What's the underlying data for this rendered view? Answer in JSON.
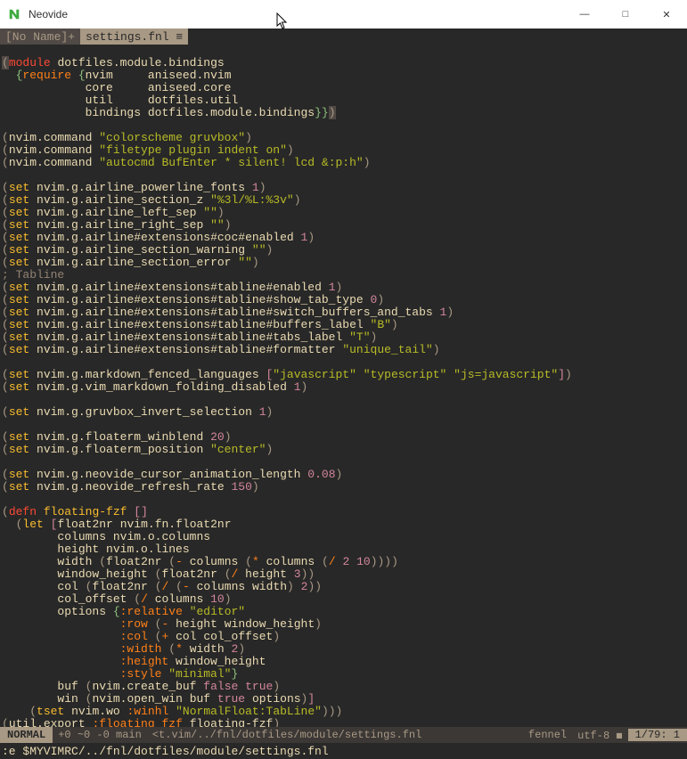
{
  "window": {
    "title": "Neovide",
    "min": "—",
    "max": "□",
    "close": "✕"
  },
  "tabs": {
    "inactive_label": "[No Name]+  ",
    "active_label": " settings.fnl ≡ "
  },
  "code": {
    "l1_mod": "module",
    "l1_name": "dotfiles.module.bindings",
    "l2_req": "require",
    "l2_nvim": "nvim",
    "l2_anvim": "aniseed.nvim",
    "l3_core": "core",
    "l3_acore": "aniseed.core",
    "l4_util": "util",
    "l4_dutil": "dotfiles.util",
    "l5_bind": "bindings",
    "l5_dbind": "dotfiles.module.bindings",
    "cmd": "nvim.command",
    "cs": "\"colorscheme gruvbox\"",
    "ft": "\"filetype plugin indent on\"",
    "ac": "\"autocmd BufEnter * silent! lcd &:p:h\"",
    "set": "set",
    "s1": "nvim.g.airline_powerline_fonts",
    "n1": "1",
    "s2": "nvim.g.airline_section_z",
    "v2": "\"%3l/%L:%3v\"",
    "s3": "nvim.g.airline_left_sep",
    "v3": "\"\"",
    "s4": "nvim.g.airline_right_sep",
    "v4": "\"\"",
    "s5": "nvim.g.airline#extensions#coc#enabled",
    "n5": "1",
    "s6": "nvim.g.airline_section_warning",
    "v6": "\"\"",
    "s7": "nvim.g.airline_section_error",
    "v7": "\"\"",
    "cmt_tab": "; Tabline",
    "s8": "nvim.g.airline#extensions#tabline#enabled",
    "n8": "1",
    "s9": "nvim.g.airline#extensions#tabline#show_tab_type",
    "n9": "0",
    "s10": "nvim.g.airline#extensions#tabline#switch_buffers_and_tabs",
    "n10": "1",
    "s11": "nvim.g.airline#extensions#tabline#buffers_label",
    "v11": "\"B\"",
    "s12": "nvim.g.airline#extensions#tabline#tabs_label",
    "v12": "\"T\"",
    "s13": "nvim.g.airline#extensions#tabline#formatter",
    "v13": "\"unique_tail\"",
    "s14": "nvim.g.markdown_fenced_languages",
    "v14a": "\"javascript\"",
    "v14b": "\"typescript\"",
    "v14c": "\"js=javascript\"",
    "s15": "nvim.g.vim_markdown_folding_disabled",
    "n15": "1",
    "s16": "nvim.g.gruvbox_invert_selection",
    "n16": "1",
    "s17": "nvim.g.floaterm_winblend",
    "n17": "20",
    "s18": "nvim.g.floaterm_position",
    "v18": "\"center\"",
    "s19": "nvim.g.neovide_cursor_animation_length",
    "n19": "0.08",
    "s20": "nvim.g.neovide_refresh_rate",
    "n20": "150",
    "defn": "defn",
    "fzf": "floating-fzf",
    "let": "let",
    "f2n": "float2nr",
    "f2nv": "nvim.fn.float2nr",
    "cols": "columns",
    "colsv": "nvim.o.columns",
    "hght": "height",
    "hghtv": "nvim.o.lines",
    "wdth": "width",
    "whght": "window_height",
    "col": "col",
    "coloff": "col_offset",
    "opts": "options",
    "rel": ":relative",
    "relv": "\"editor\"",
    "row": ":row",
    "kcol": ":col",
    "kwidth": ":width",
    "kheight": ":height",
    "kstyle": ":style",
    "stylev": "\"minimal\"",
    "buf": "buf",
    "bufv": "nvim.create_buf",
    "false": "false",
    "true": "true",
    "win": "win",
    "winv": "nvim.open_win",
    "tset": "tset",
    "tset1": "nvim.wo",
    "tset2": ":winhl",
    "tset3": "\"NormalFloat:TabLine\"",
    "export": "util.export",
    "exp1": ":floating_fzf",
    "exp2": "floating-fzf",
    "n2": "2",
    "n3": "3",
    "n_10": "10",
    "div": "/",
    "mul": "*",
    "min": "-",
    "plus": "+"
  },
  "status": {
    "mode": "NORMAL",
    "git": " +0 ~0 -0  main ",
    "file": " <t.vim/../fnl/dotfiles/module/settings.fnl ",
    "ft": "fennel ",
    "enc": " utf-8 ◼ ",
    "pos": "  1/79:   1 "
  },
  "cmdline": ":e $MYVIMRC/../fnl/dotfiles/module/settings.fnl"
}
